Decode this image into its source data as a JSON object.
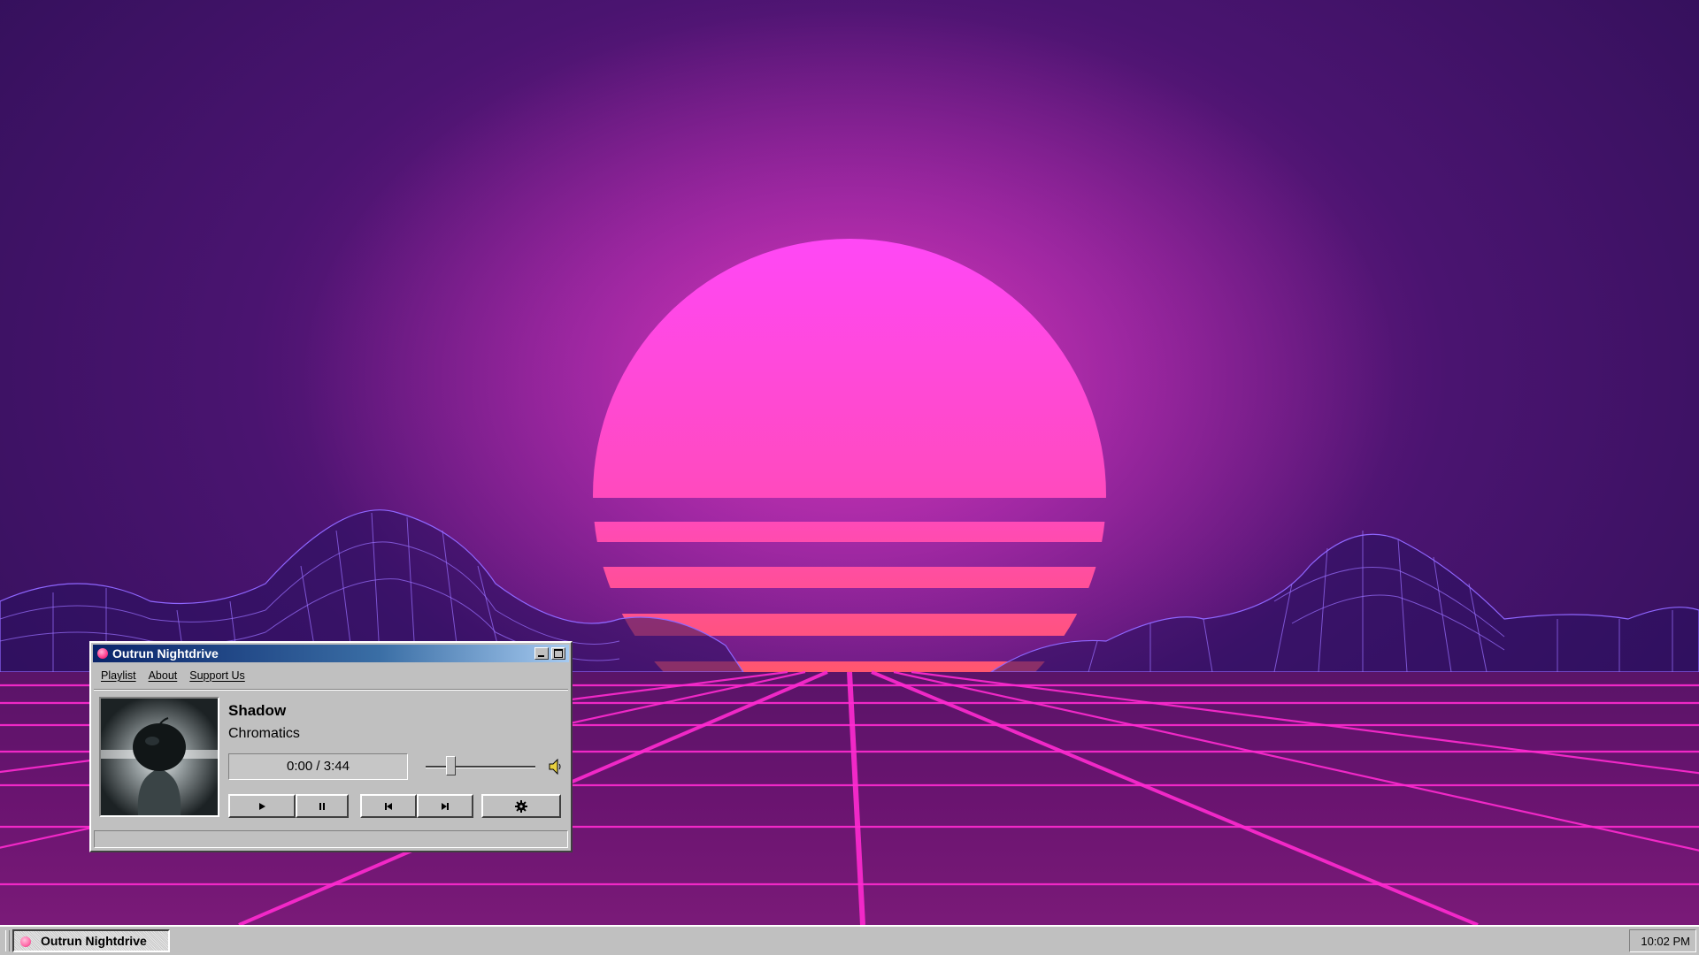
{
  "window": {
    "title": "Outrun Nightdrive",
    "menu": [
      "Playlist",
      "About",
      "Support Us"
    ]
  },
  "player": {
    "track_title": "Shadow",
    "artist": "Chromatics",
    "time_display": "0:00 / 3:44",
    "volume": 0.2
  },
  "icons": {
    "play": "play-icon",
    "pause": "pause-icon",
    "previous": "skip-back-icon",
    "next": "skip-forward-icon",
    "settings": "gear-icon",
    "volume": "speaker-icon",
    "app": "app-icon"
  },
  "taskbar": {
    "task_label": "Outrun Nightdrive",
    "clock": "10:02 PM"
  },
  "colors": {
    "sun_top": "#ff4af5",
    "sun_bottom": "#ff5a4a",
    "grid": "#ff2ad0",
    "mountains": "#8a60ff",
    "titlebar": "#0a246a",
    "window_face": "#c0c0c0"
  }
}
